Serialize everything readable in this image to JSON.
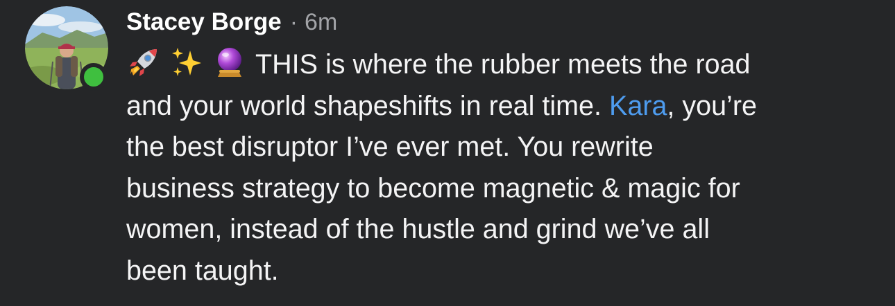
{
  "comment": {
    "author": "Stacey Borge",
    "separator": "·",
    "timestamp": "6m",
    "online": true,
    "emojis": [
      "rocket-icon",
      "sparkles-icon",
      "crystal-ball-icon"
    ],
    "body": {
      "line1_text": "THIS is where the rubber meets the road",
      "line2_before": "and your world shapeshifts in real time. ",
      "mention": "Kara",
      "line2_after": ", you’re",
      "line3": "the best disruptor I’ve ever met. You rewrite",
      "line4": "business strategy to become magnetic & magic for",
      "line5": "women, instead of the hustle and grind we’ve all",
      "line6": "been taught."
    }
  },
  "colors": {
    "background": "#252628",
    "text": "#f4f4f5",
    "muted": "#a3a4a8",
    "mention": "#4e9cef",
    "online": "#3fbf3f"
  }
}
